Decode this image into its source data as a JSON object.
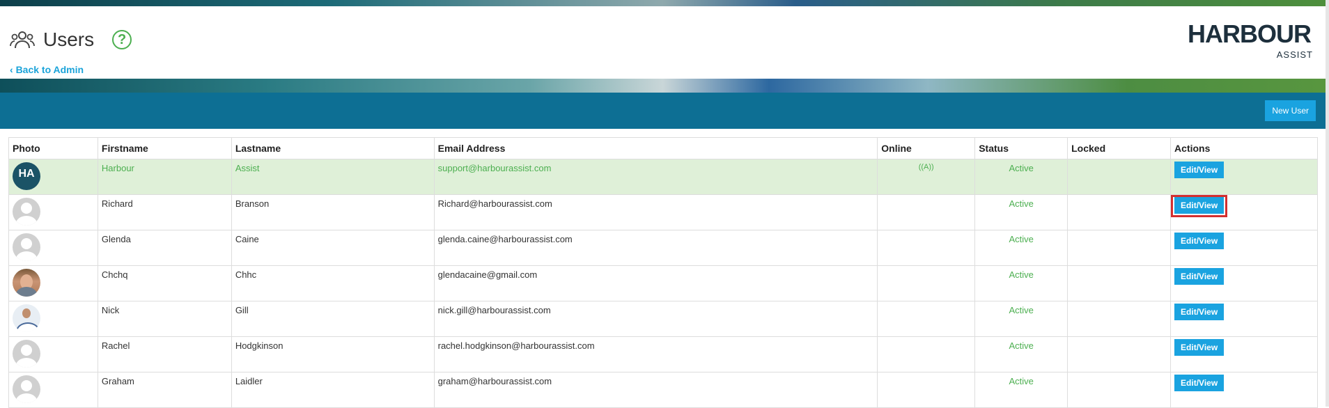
{
  "header": {
    "title": "Users",
    "help_symbol": "?",
    "back_link": "Back to Admin",
    "logo_main": "HARBOUR",
    "logo_sub": "ASSIST"
  },
  "toolbar": {
    "new_user_label": "New User"
  },
  "table": {
    "columns": [
      "Photo",
      "Firstname",
      "Lastname",
      "Email Address",
      "Online",
      "Status",
      "Locked",
      "Actions"
    ],
    "action_label": "Edit/View",
    "rows": [
      {
        "firstname": "Harbour",
        "lastname": "Assist",
        "email": "support@harbourassist.com",
        "online": "((A))",
        "status": "Active",
        "locked": "",
        "avatar": "HA"
      },
      {
        "firstname": "Richard",
        "lastname": "Branson",
        "email": "Richard@harbourassist.com",
        "online": "",
        "status": "Active",
        "locked": ""
      },
      {
        "firstname": "Glenda",
        "lastname": "Caine",
        "email": "glenda.caine@harbourassist.com",
        "online": "",
        "status": "Active",
        "locked": ""
      },
      {
        "firstname": "Chchq",
        "lastname": "Chhc",
        "email": "glendacaine@gmail.com",
        "online": "",
        "status": "Active",
        "locked": ""
      },
      {
        "firstname": "Nick",
        "lastname": "Gill",
        "email": "nick.gill@harbourassist.com",
        "online": "",
        "status": "Active",
        "locked": ""
      },
      {
        "firstname": "Rachel",
        "lastname": "Hodgkinson",
        "email": "rachel.hodgkinson@harbourassist.com",
        "online": "",
        "status": "Active",
        "locked": ""
      },
      {
        "firstname": "Graham",
        "lastname": "Laidler",
        "email": "graham@harbourassist.com",
        "online": "",
        "status": "Active",
        "locked": ""
      }
    ]
  },
  "colors": {
    "accent": "#1aa3e0",
    "teal_bar": "#0d6f94",
    "status_green": "#4caf50",
    "highlight_row": "#dff0d8"
  }
}
